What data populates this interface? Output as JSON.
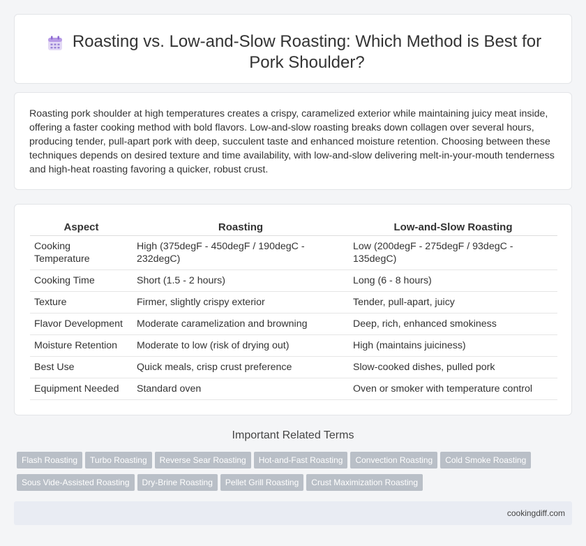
{
  "header": {
    "title": "Roasting vs. Low-and-Slow Roasting: Which Method is Best for Pork Shoulder?",
    "icon": "calendar-icon"
  },
  "intro": {
    "text": "Roasting pork shoulder at high temperatures creates a crispy, caramelized exterior while maintaining juicy meat inside, offering a faster cooking method with bold flavors. Low-and-slow roasting breaks down collagen over several hours, producing tender, pull-apart pork with deep, succulent taste and enhanced moisture retention. Choosing between these techniques depends on desired texture and time availability, with low-and-slow delivering melt-in-your-mouth tenderness and high-heat roasting favoring a quicker, robust crust."
  },
  "table": {
    "headers": [
      "Aspect",
      "Roasting",
      "Low-and-Slow Roasting"
    ],
    "rows": [
      [
        "Cooking Temperature",
        "High (375degF - 450degF / 190degC - 232degC)",
        "Low (200degF - 275degF / 93degC - 135degC)"
      ],
      [
        "Cooking Time",
        "Short (1.5 - 2 hours)",
        "Long (6 - 8 hours)"
      ],
      [
        "Texture",
        "Firmer, slightly crispy exterior",
        "Tender, pull-apart, juicy"
      ],
      [
        "Flavor Development",
        "Moderate caramelization and browning",
        "Deep, rich, enhanced smokiness"
      ],
      [
        "Moisture Retention",
        "Moderate to low (risk of drying out)",
        "High (maintains juiciness)"
      ],
      [
        "Best Use",
        "Quick meals, crisp crust preference",
        "Slow-cooked dishes, pulled pork"
      ],
      [
        "Equipment Needed",
        "Standard oven",
        "Oven or smoker with temperature control"
      ]
    ]
  },
  "related": {
    "title": "Important Related Terms",
    "tags": [
      "Flash Roasting",
      "Turbo Roasting",
      "Reverse Sear Roasting",
      "Hot-and-Fast Roasting",
      "Convection Roasting",
      "Cold Smoke Roasting",
      "Sous Vide-Assisted Roasting",
      "Dry-Brine Roasting",
      "Pellet Grill Roasting",
      "Crust Maximization Roasting"
    ]
  },
  "footer": {
    "site": "cookingdiff.com"
  }
}
